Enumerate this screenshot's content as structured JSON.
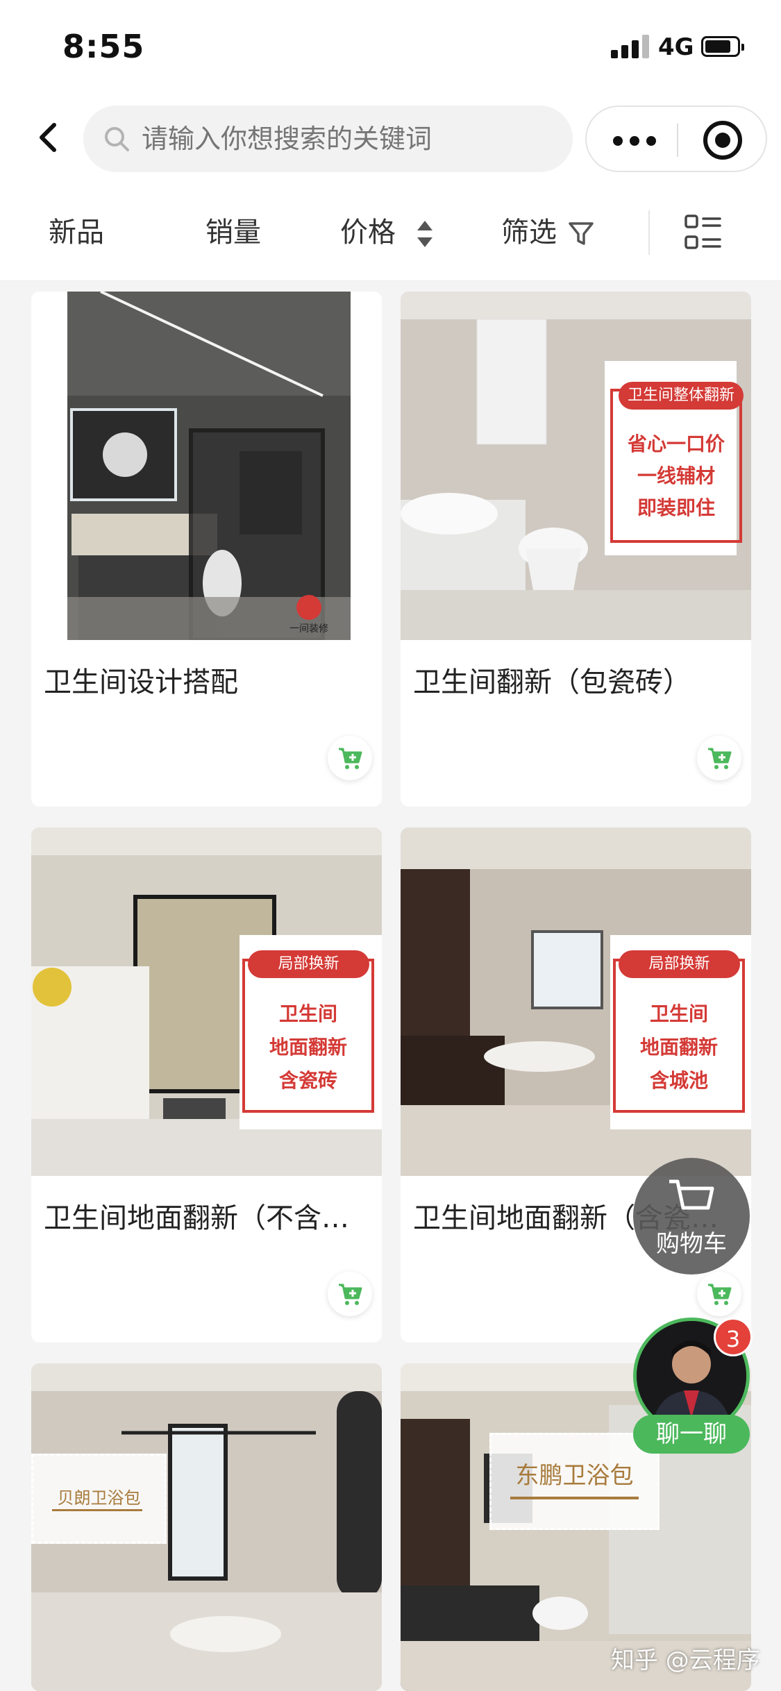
{
  "status_bar": {
    "time": "8:55",
    "network": "4G"
  },
  "search": {
    "placeholder": "请输入你想搜索的关键词"
  },
  "sort": {
    "new": "新品",
    "sales": "销量",
    "price": "价格",
    "filter": "筛选"
  },
  "products": [
    {
      "title": "卫生间设计搭配",
      "logo_text": "一间装修"
    },
    {
      "title": "卫生间翻新（包瓷砖）",
      "promo": {
        "tag": "卫生间整体翻新",
        "lines": [
          "省心一口价",
          "一线辅材",
          "即装即住"
        ]
      }
    },
    {
      "title": "卫生间地面翻新（不含瓷砖）",
      "promo": {
        "tag": "局部换新",
        "lines": [
          "卫生间",
          "地面翻新",
          "含瓷砖"
        ]
      }
    },
    {
      "title": "卫生间地面翻新（含瓷砖）",
      "promo": {
        "tag": "局部换新",
        "lines": [
          "卫生间",
          "地面翻新",
          "含城池"
        ]
      }
    },
    {
      "title": "",
      "promo_plain": "贝朗卫浴包"
    },
    {
      "title": "",
      "promo_plain": "东鹏卫浴包"
    }
  ],
  "floating": {
    "cart_label": "购物车",
    "chat_label": "聊一聊",
    "chat_badge": "3"
  },
  "watermark": "知乎 @云程序",
  "colors": {
    "promo_red": "#d43a36",
    "accent_green": "#4cb85c",
    "badge_red": "#e3413a"
  }
}
